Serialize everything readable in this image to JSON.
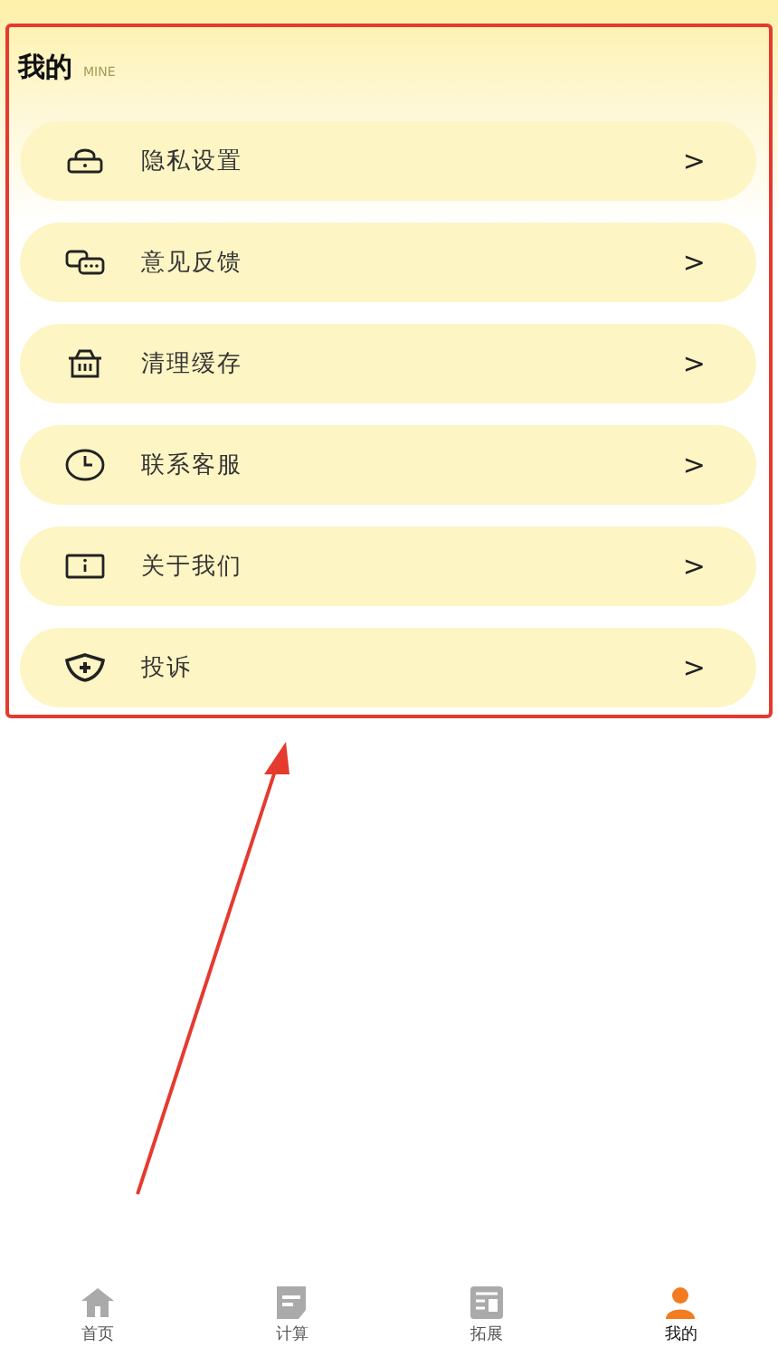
{
  "header": {
    "title": "我的",
    "subtitle": "MINE"
  },
  "menu": [
    {
      "label": "隐私设置",
      "chevron": ">"
    },
    {
      "label": "意见反馈",
      "chevron": ">"
    },
    {
      "label": "清理缓存",
      "chevron": ">"
    },
    {
      "label": "联系客服",
      "chevron": ">"
    },
    {
      "label": "关于我们",
      "chevron": ">"
    },
    {
      "label": "投诉",
      "chevron": ">"
    }
  ],
  "tab_bar": [
    {
      "label": "首页",
      "selected": false
    },
    {
      "label": "计算",
      "selected": false
    },
    {
      "label": "拓展",
      "selected": false
    },
    {
      "label": "我的",
      "selected": true
    }
  ]
}
